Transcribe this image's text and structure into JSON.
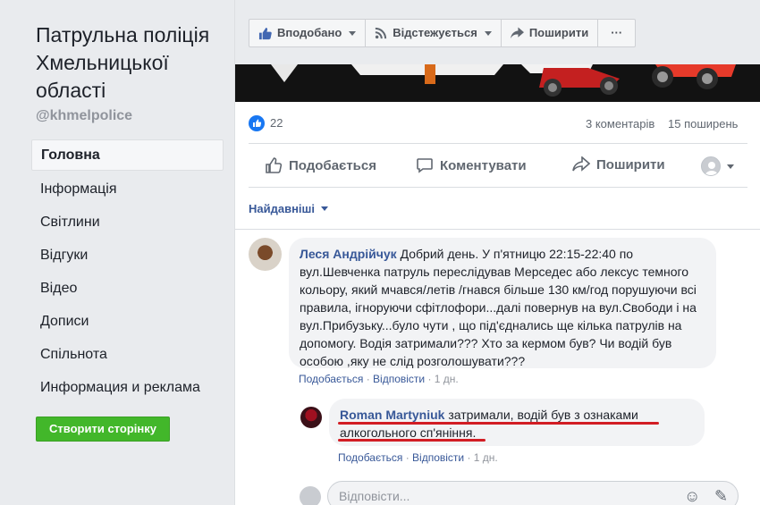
{
  "sidebar": {
    "page_title": "Патрульна поліція Хмельницької області",
    "handle": "@khmelpolice",
    "nav": [
      {
        "label": "Головна"
      },
      {
        "label": "Інформація"
      },
      {
        "label": "Світлини"
      },
      {
        "label": "Відгуки"
      },
      {
        "label": "Відео"
      },
      {
        "label": "Дописи"
      },
      {
        "label": "Спільнота"
      },
      {
        "label": "Информация и реклама"
      }
    ],
    "create_page": "Створити сторінку"
  },
  "toolbar": {
    "liked": "Вподобано",
    "following": "Відстежується",
    "share": "Поширити",
    "more": "···"
  },
  "post": {
    "likes": "22",
    "comments": "3 коментарів",
    "shares": "15 поширень",
    "actions": {
      "like": "Подобається",
      "comment": "Коментувати",
      "share": "Поширити"
    }
  },
  "sort_label": "Найдавніші",
  "comment": {
    "author": "Леся Андрійчук",
    "text": "Добрий день. У п'ятницю 22:15-22:40 по вул.Шевченка патруль переслідував Мерседес або лексус темного кольору, який мчався/летів /гнався більше 130 км/год порушуючи всі правила, ігноруючи сфітлофори...далі повернув на вул.Свободи і на вул.Прибузьку...було чути , що під'єднались ще кілька патрулів на допомогу. Водія затримали??? Хто за кермом був? Чи водій був особою ,яку не слід розголошувати???",
    "like": "Подобається",
    "reply": "Відповісти",
    "time": "1 дн."
  },
  "reply": {
    "author": "Roman Martyniuk",
    "text_line1": "затримали, водій був з ознаками",
    "text_line2": "алкогольного сп'яніння.",
    "like": "Подобається",
    "reply": "Відповісти",
    "time": "1 дн."
  },
  "reply_input": {
    "placeholder": "Відповісти..."
  },
  "colors": {
    "link": "#385898",
    "create_button": "#42b72a",
    "highlight_underline": "#d21d24"
  }
}
